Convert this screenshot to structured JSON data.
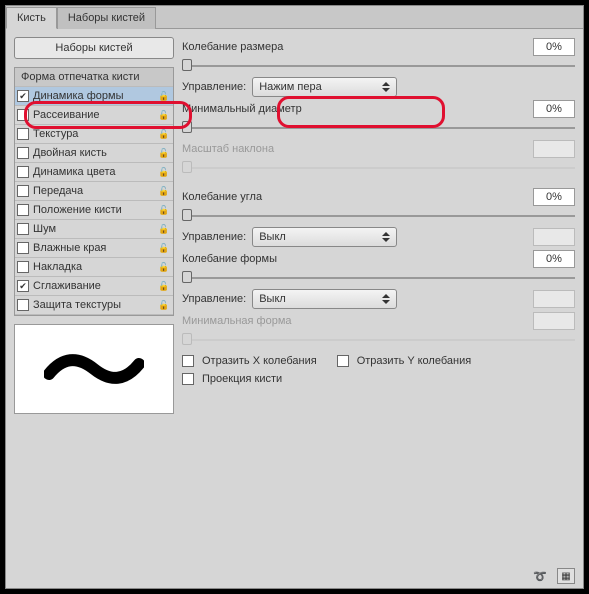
{
  "tabs": {
    "brush": "Кисть",
    "presets": "Наборы кистей"
  },
  "sidebar": {
    "presets_btn": "Наборы кистей",
    "header": "Форма отпечатка кисти",
    "items": [
      {
        "label": "Динамика формы",
        "checked": true,
        "selected": true
      },
      {
        "label": "Рассеивание",
        "checked": false
      },
      {
        "label": "Текстура",
        "checked": false
      },
      {
        "label": "Двойная кисть",
        "checked": false
      },
      {
        "label": "Динамика цвета",
        "checked": false
      },
      {
        "label": "Передача",
        "checked": false
      },
      {
        "label": "Положение кисти",
        "checked": false
      },
      {
        "label": "Шум",
        "checked": false
      },
      {
        "label": "Влажные края",
        "checked": false
      },
      {
        "label": "Накладка",
        "checked": false
      },
      {
        "label": "Сглаживание",
        "checked": true
      },
      {
        "label": "Защита текстуры",
        "checked": false
      }
    ]
  },
  "controls": {
    "size_jitter": {
      "label": "Колебание размера",
      "value": "0%"
    },
    "control1": {
      "label": "Управление:",
      "value": "Нажим пера"
    },
    "min_diam": {
      "label": "Минимальный диаметр",
      "value": "0%"
    },
    "tilt_scale": {
      "label": "Масштаб наклона"
    },
    "angle_jitter": {
      "label": "Колебание угла",
      "value": "0%"
    },
    "control2": {
      "label": "Управление:",
      "value": "Выкл"
    },
    "round_jitter": {
      "label": "Колебание формы",
      "value": "0%"
    },
    "control3": {
      "label": "Управление:",
      "value": "Выкл"
    },
    "min_round": {
      "label": "Минимальная форма"
    },
    "flip_x": "Отразить X колебания",
    "flip_y": "Отразить Y колебания",
    "brush_proj": "Проекция кисти"
  }
}
